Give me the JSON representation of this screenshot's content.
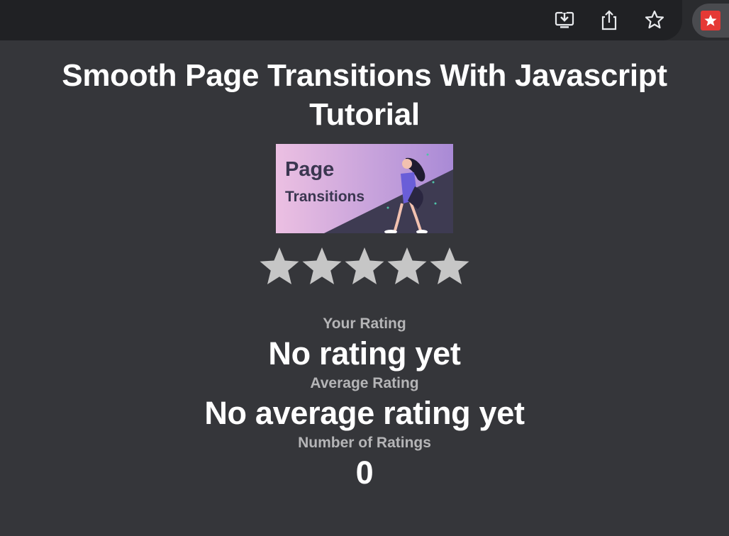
{
  "browser": {
    "icons": [
      "install-icon",
      "share-icon",
      "bookmark-star-icon",
      "extension-star-icon"
    ]
  },
  "page": {
    "title": "Smooth Page Transitions With Javascript Tutorial",
    "thumbnail": {
      "line1": "Page",
      "line2": "Transitions"
    },
    "rating": {
      "stars_max": 5,
      "stars_filled": 0,
      "your_rating_label": "Your Rating",
      "your_rating_value": "No rating yet",
      "average_label": "Average Rating",
      "average_value": "No average rating yet",
      "count_label": "Number of Ratings",
      "count_value": "0"
    }
  },
  "colors": {
    "background": "#35363a",
    "star": "#c6c6c6",
    "extension_accent": "#e53935"
  }
}
